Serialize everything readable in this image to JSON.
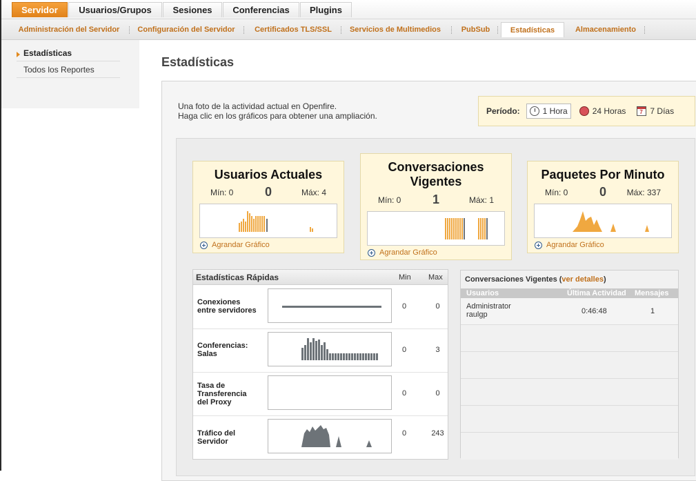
{
  "top_tabs": [
    {
      "label": "Servidor",
      "active": true
    },
    {
      "label": "Usuarios/Grupos",
      "active": false
    },
    {
      "label": "Sesiones",
      "active": false
    },
    {
      "label": "Conferencias",
      "active": false
    },
    {
      "label": "Plugins",
      "active": false
    }
  ],
  "sub_tabs": [
    {
      "label": "Administración del Servidor",
      "active": false
    },
    {
      "label": "Configuración del Servidor",
      "active": false
    },
    {
      "label": "Certificados TLS/SSL",
      "active": false
    },
    {
      "label": "Servicios de Multimedios",
      "active": false
    },
    {
      "label": "PubSub",
      "active": false
    },
    {
      "label": "Estadísticas",
      "active": true
    },
    {
      "label": "Almacenamiento",
      "active": false
    }
  ],
  "sidebar": {
    "items": [
      {
        "label": "Estadísticas",
        "active": true
      },
      {
        "label": "Todos los Reportes",
        "active": false
      }
    ]
  },
  "page": {
    "title": "Estadísticas",
    "intro_line1": "Una foto de la actividad actual en Openfire.",
    "intro_line2": "Haga clic en los gráficos para obtener una ampliación."
  },
  "period": {
    "label": "Período:",
    "options": [
      {
        "label": "1 Hora",
        "icon": "clock-icon",
        "selected": true
      },
      {
        "label": "24 Horas",
        "icon": "clock-24-icon",
        "selected": false
      },
      {
        "label": "7 Días",
        "icon": "calendar-icon",
        "selected": false
      }
    ],
    "calendar_number": "7"
  },
  "stats": [
    {
      "title": "Usuarios Actuales",
      "min": "Mín: 0",
      "current": "0",
      "max": "Máx: 4",
      "enlarge": "Agrandar Gráfico"
    },
    {
      "title": "Conversaciones Vigentes",
      "min": "Mín: 0",
      "current": "1",
      "max": "Máx: 1",
      "enlarge": "Agrandar Gráfico"
    },
    {
      "title": "Paquetes Por Minuto",
      "min": "Mín: 0",
      "current": "0",
      "max": "Máx: 337",
      "enlarge": "Agrandar Gráfico"
    }
  ],
  "quick_stats": {
    "title": "Estadísticas Rápidas",
    "col_min": "Min",
    "col_max": "Max",
    "rows": [
      {
        "label": "Conexiones entre servidores",
        "min": "0",
        "max": "0"
      },
      {
        "label": "Conferencias: Salas",
        "min": "0",
        "max": "3"
      },
      {
        "label": "Tasa de Transferencia del Proxy",
        "min": "0",
        "max": "0"
      },
      {
        "label": "Tráfico del Servidor",
        "min": "0",
        "max": "243"
      }
    ]
  },
  "conversations": {
    "title_prefix": "Conversaciones Vigentes (",
    "link": "ver detalles",
    "title_suffix": ")",
    "columns": [
      "Usuarios",
      "Última Actividad",
      "Mensajes"
    ],
    "rows": [
      {
        "user1": "Administrator",
        "user2": "raulgp",
        "last_activity": "0:46:48",
        "messages": "1"
      }
    ]
  },
  "colors": {
    "accent": "#e1821a",
    "link": "#c0701b",
    "panel_yellow": "#fff7dc",
    "chart_orange": "#f0a840",
    "chart_gray": "#6d7378"
  }
}
